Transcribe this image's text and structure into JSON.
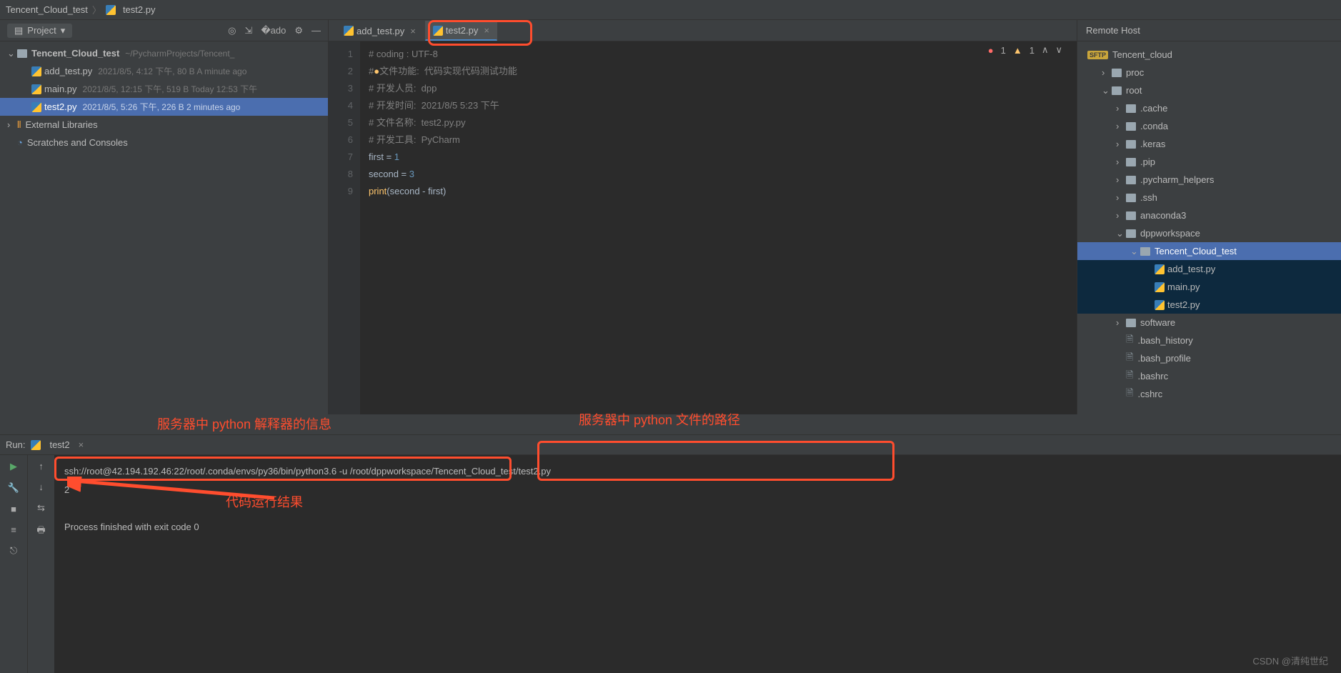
{
  "breadcrumb": {
    "root": "Tencent_Cloud_test",
    "file": "test2.py"
  },
  "project": {
    "label": "Project",
    "root": {
      "name": "Tencent_Cloud_test",
      "path": "~/PycharmProjects/Tencent_"
    },
    "files": [
      {
        "name": "add_test.py",
        "meta": "2021/8/5, 4:12 下午, 80 B A minute ago"
      },
      {
        "name": "main.py",
        "meta": "2021/8/5, 12:15 下午, 519 B Today 12:53 下午"
      },
      {
        "name": "test2.py",
        "meta": "2021/8/5, 5:26 下午, 226 B 2 minutes ago"
      }
    ],
    "ext": "External Libraries",
    "scratch": "Scratches and Consoles"
  },
  "tabs": [
    {
      "label": "add_test.py"
    },
    {
      "label": "test2.py"
    }
  ],
  "inspect": {
    "err": "1",
    "warn": "1"
  },
  "code": {
    "l1": "# coding : UTF-8",
    "l2a": "#",
    "l2b": "文件功能:  代码实现代码测试功能",
    "l3": "# 开发人员:  dpp",
    "l4": "# 开发时间:  2021/8/5 5:23 下午",
    "l5": "# 文件名称:  test2.py.py",
    "l6": "# 开发工具:  PyCharm",
    "v1": "first",
    "v2": "second",
    "n1": "1",
    "n3": "3",
    "pr": "print"
  },
  "remote": {
    "title": "Remote Host",
    "host": "Tencent_cloud",
    "tree": [
      {
        "t": "proc",
        "d": 1,
        "chev": ">",
        "f": 1
      },
      {
        "t": "root",
        "d": 1,
        "chev": "v",
        "f": 1
      },
      {
        "t": ".cache",
        "d": 2,
        "chev": ">",
        "f": 1
      },
      {
        "t": ".conda",
        "d": 2,
        "chev": ">",
        "f": 1
      },
      {
        "t": ".keras",
        "d": 2,
        "chev": ">",
        "f": 1
      },
      {
        "t": ".pip",
        "d": 2,
        "chev": ">",
        "f": 1
      },
      {
        "t": ".pycharm_helpers",
        "d": 2,
        "chev": ">",
        "f": 1
      },
      {
        "t": ".ssh",
        "d": 2,
        "chev": ">",
        "f": 1
      },
      {
        "t": "anaconda3",
        "d": 2,
        "chev": ">",
        "f": 1
      },
      {
        "t": "dppworkspace",
        "d": 2,
        "chev": "v",
        "f": 1
      },
      {
        "t": "Tencent_Cloud_test",
        "d": 3,
        "chev": "v",
        "f": 1,
        "sel": 1
      },
      {
        "t": "add_test.py",
        "d": 4,
        "py": 1,
        "selbg": 1
      },
      {
        "t": "main.py",
        "d": 4,
        "py": 1,
        "selbg": 1
      },
      {
        "t": "test2.py",
        "d": 4,
        "py": 1,
        "selbg": 1
      },
      {
        "t": "software",
        "d": 2,
        "chev": ">",
        "f": 1
      },
      {
        "t": ".bash_history",
        "d": 2,
        "file": 1
      },
      {
        "t": ".bash_profile",
        "d": 2,
        "file": 1
      },
      {
        "t": ".bashrc",
        "d": 2,
        "file": 1
      },
      {
        "t": ".cshrc",
        "d": 2,
        "file": 1
      }
    ]
  },
  "annot": {
    "a1": "服务器中 python 解释器的信息",
    "a2": "服务器中 python 文件的路径",
    "a3": "代码运行结果"
  },
  "run": {
    "label": "Run:",
    "tab": "test2",
    "cmd1": "ssh://root@42.194.192.46:22/root/.conda/envs/py36/bin/python3.6",
    "cmdmid": " -u ",
    "cmd2": "/root/dppworkspace/Tencent_Cloud_test/test2.py",
    "out": "2",
    "exit": "Process finished with exit code 0"
  },
  "watermark": "CSDN @清纯世纪"
}
